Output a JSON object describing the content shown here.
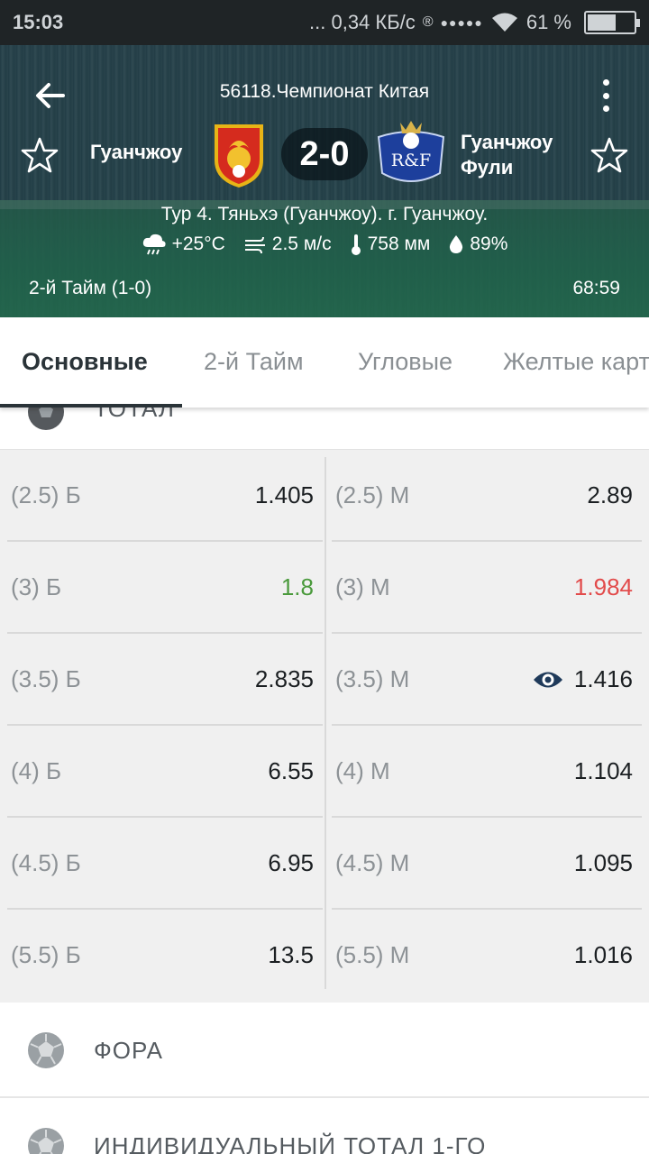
{
  "status_bar": {
    "time": "15:03",
    "network": "... 0,34 КБ/с",
    "registered_mark": "®",
    "signal": "●●●●●",
    "battery": "61 %",
    "battery_level": 0.61
  },
  "match": {
    "league": "56118.Чемпионат Китая",
    "home_team": "Гуанчжоу",
    "away_team_line1": "Гуанчжоу",
    "away_team_line2": "Фули",
    "away_logo_text": "R&F",
    "score": "2-0",
    "venue": "Тур 4. Тяньхэ (Гуанчжоу). г. Гуанчжоу.",
    "weather": {
      "temperature": "+25°C",
      "wind": "2.5 м/с",
      "pressure": "758 мм",
      "humidity": "89%"
    },
    "period": "2-й  Тайм (1-0)",
    "clock": "68:59"
  },
  "tabs": [
    {
      "label": "Основные",
      "active": true
    },
    {
      "label": "2-й  Тайм",
      "active": false
    },
    {
      "label": "Угловые",
      "active": false
    },
    {
      "label": "Желтые карточки",
      "active": false
    }
  ],
  "current_section": "ТОТАЛ",
  "odds": [
    {
      "over_label": "(2.5) Б",
      "over_value": "1.405",
      "under_label": "(2.5) М",
      "under_value": "2.89"
    },
    {
      "over_label": "(3) Б",
      "over_value": "1.8",
      "over_trend": "up",
      "under_label": "(3) М",
      "under_value": "1.984",
      "under_trend": "down"
    },
    {
      "over_label": "(3.5) Б",
      "over_value": "2.835",
      "under_label": "(3.5) М",
      "under_value": "1.416",
      "under_icon": "eye-icon"
    },
    {
      "over_label": "(4) Б",
      "over_value": "6.55",
      "under_label": "(4) М",
      "under_value": "1.104"
    },
    {
      "over_label": "(4.5) Б",
      "over_value": "6.95",
      "under_label": "(4.5) М",
      "under_value": "1.095"
    },
    {
      "over_label": "(5.5) Б",
      "over_value": "13.5",
      "under_label": "(5.5) М",
      "under_value": "1.016"
    }
  ],
  "sections": [
    {
      "label": "ФОРА"
    },
    {
      "label": "ИНДИВИДУАЛЬНЫЙ ТОТАЛ 1-ГО"
    }
  ],
  "colors": {
    "trend_up": "#4a9a3c",
    "trend_down": "#e24b4b",
    "tab_active": "#2a3338"
  }
}
